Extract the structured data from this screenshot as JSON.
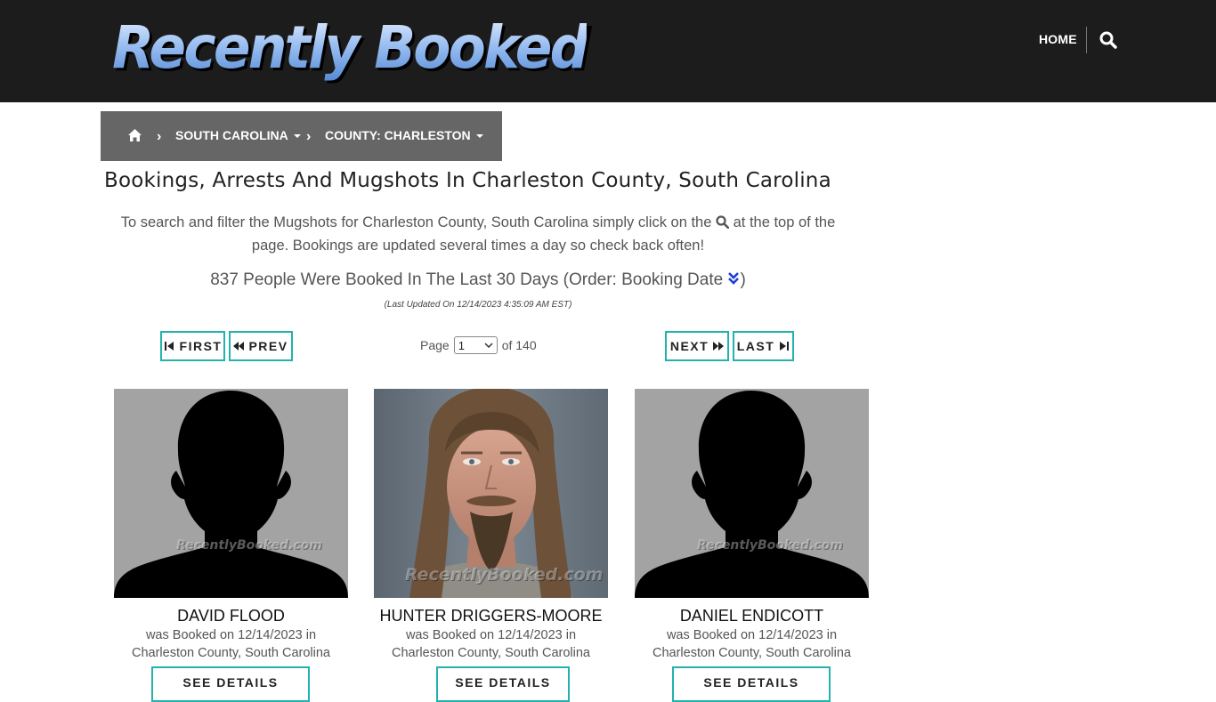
{
  "site": {
    "logo_text": "Recently Booked",
    "nav_home": "HOME",
    "search_icon": "search-icon"
  },
  "breadcrumb": {
    "state": "SOUTH CAROLINA",
    "county": "COUNTY: CHARLESTON",
    "separator": "›"
  },
  "page": {
    "title": "Bookings, Arrests And Mugshots In Charleston County, South Carolina",
    "intro_before": "To search and filter the Mugshots for Charleston County, South Carolina simply click on the",
    "intro_after": "at the top of the page. Bookings are updated several times a day so check back often!",
    "count_text": "837 People Were Booked In The Last 30 Days (Order: Booking Date",
    "count_close": ")",
    "updated": "(Last Updated On 12/14/2023 4:35:09 AM EST)"
  },
  "pager": {
    "first": "FIRST",
    "prev": "PREV",
    "next": "NEXT",
    "last": "LAST",
    "page_label": "Page",
    "current_page": "1",
    "of_label": "of 140"
  },
  "bookings": [
    {
      "name": "DAVID FLOOD",
      "line1": "was Booked on 12/14/2023 in",
      "line2": "Charleston County, South Carolina",
      "button": "SEE DETAILS",
      "photo": "silhouette"
    },
    {
      "name": "HUNTER DRIGGERS-MOORE",
      "line1": "was Booked on 12/14/2023 in",
      "line2": "Charleston County, South Carolina",
      "button": "SEE DETAILS",
      "photo": "mugshot"
    },
    {
      "name": "DANIEL ENDICOTT",
      "line1": "was Booked on 12/14/2023 in",
      "line2": "Charleston County, South Carolina",
      "button": "SEE DETAILS",
      "photo": "silhouette"
    }
  ],
  "watermark": "RecentlyBooked.com",
  "colors": {
    "header_bg": "#1c1c1c",
    "breadcrumb_bg": "#666666",
    "accent_border": "#22b2b0",
    "sort_icon": "#1a3fd6"
  }
}
